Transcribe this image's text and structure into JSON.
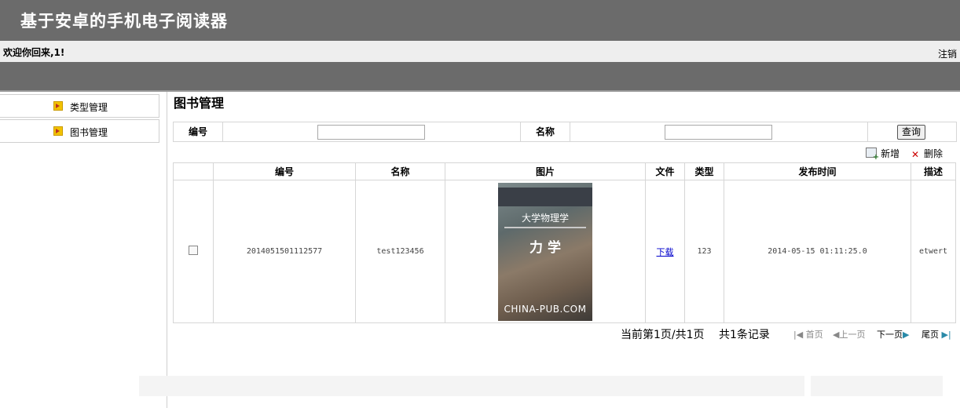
{
  "header": {
    "title": "基于安卓的手机电子阅读器"
  },
  "userbar": {
    "welcome": "欢迎你回来,1!",
    "logout": "注销"
  },
  "sidebar": {
    "items": [
      {
        "label": "类型管理"
      },
      {
        "label": "图书管理"
      }
    ]
  },
  "main": {
    "title": "图书管理",
    "search": {
      "field1_label": "编号",
      "field1_value": "",
      "field2_label": "名称",
      "field2_value": "",
      "button": "查询"
    },
    "actions": {
      "add": "新增",
      "delete": "删除"
    },
    "table": {
      "columns": [
        "编号",
        "名称",
        "图片",
        "文件",
        "类型",
        "发布时间",
        "描述"
      ],
      "rows": [
        {
          "id": "2014051501112577",
          "name": "test123456",
          "image": {
            "title": "大学物理学",
            "subtitle": "力 学",
            "watermark": "CHINA-PUB.COM"
          },
          "file_link": "下载",
          "type": "123",
          "publish_time": "2014-05-15 01:11:25.0",
          "desc": "etwert"
        }
      ]
    },
    "pager": {
      "current": "当前第1页/共1页",
      "total": "共1条记录",
      "first": "首页",
      "prev": "上一页",
      "next": "下一页",
      "last": "尾页"
    }
  }
}
